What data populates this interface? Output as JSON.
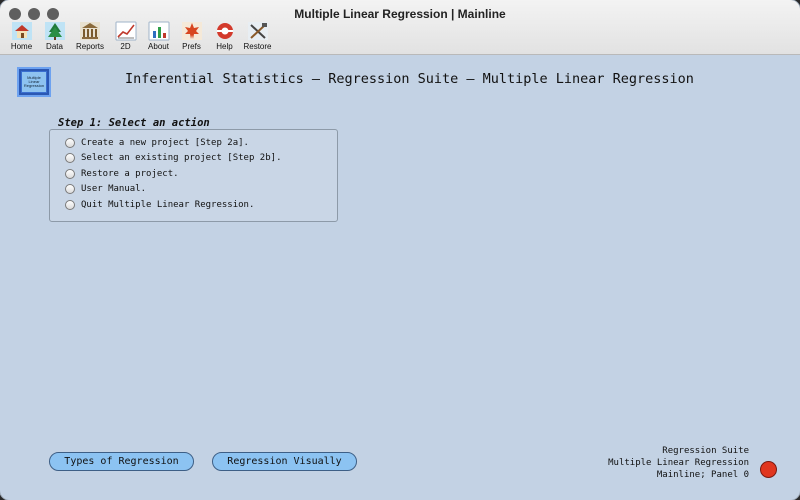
{
  "window": {
    "title": "Multiple Linear Regression | Mainline"
  },
  "toolbar": {
    "items": [
      {
        "label": "Home",
        "icon": "home-icon"
      },
      {
        "label": "Data",
        "icon": "tree-icon"
      },
      {
        "label": "Reports",
        "icon": "bank-icon"
      },
      {
        "label": "2D",
        "icon": "line-chart-icon"
      },
      {
        "label": "About",
        "icon": "bar-chart-icon"
      },
      {
        "label": "Prefs",
        "icon": "maple-leaf-icon"
      },
      {
        "label": "Help",
        "icon": "life-ring-icon"
      },
      {
        "label": "Restore",
        "icon": "tools-icon"
      }
    ]
  },
  "header": {
    "logo_text": "Multiple Linear Regression",
    "title": "Inferential Statistics — Regression Suite — Multiple Linear Regression"
  },
  "step1": {
    "heading": "Step 1: Select an action",
    "options": [
      "Create a new project [Step 2a].",
      "Select an existing project [Step 2b].",
      "Restore a project.",
      "User Manual.",
      "Quit Multiple Linear Regression."
    ]
  },
  "footer": {
    "types_button": "Types of Regression",
    "visual_button": "Regression Visually",
    "status_lines": [
      "Regression Suite",
      "Multiple Linear Regression",
      "Mainline; Panel 0"
    ],
    "status_color": "#e0361f"
  }
}
